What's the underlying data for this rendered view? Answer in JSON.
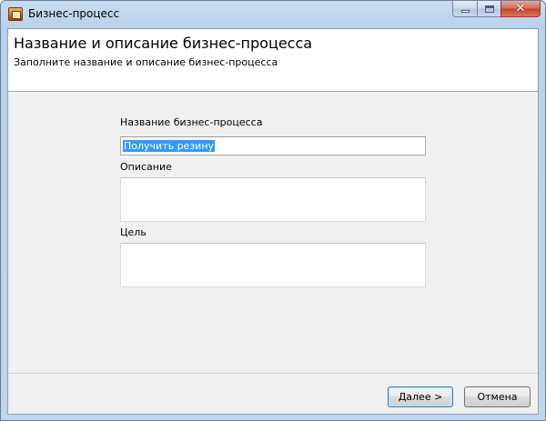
{
  "window": {
    "title": "Бизнес-процесс",
    "icon": "app-icon",
    "controls": {
      "minimize": "minimize-icon",
      "maximize": "maximize-icon",
      "close": "✕"
    }
  },
  "header": {
    "title": "Название и описание бизнес-процесса",
    "subtitle": "Заполните название и описание бизнес-процесса"
  },
  "form": {
    "name_label": "Название бизнес-процесса",
    "name_value": "Получить резину",
    "description_label": "Описание",
    "description_value": "",
    "goal_label": "Цель",
    "goal_value": ""
  },
  "buttons": {
    "next": "Далее >",
    "cancel": "Отмена"
  },
  "colors": {
    "selection": "#3399ff",
    "titlebar": "#b9d1ea",
    "close_button": "#c0432b"
  }
}
